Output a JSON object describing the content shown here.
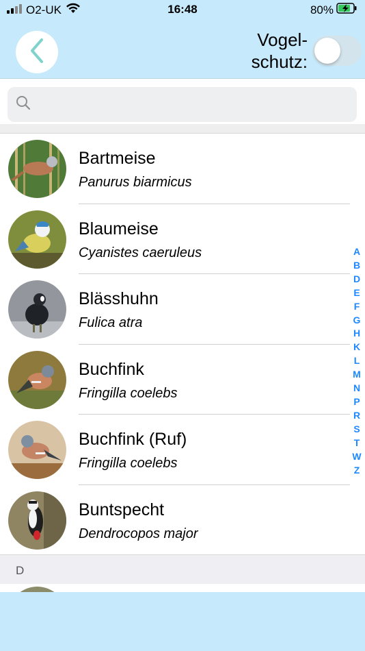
{
  "status": {
    "carrier": "O2-UK",
    "time": "16:48",
    "battery": "80%"
  },
  "header": {
    "toggle_label_line1": "Vogel-",
    "toggle_label_line2": "schutz:",
    "toggle_on": false
  },
  "search": {
    "value": "",
    "placeholder": ""
  },
  "birds": [
    {
      "name": "Bartmeise",
      "latin": "Panurus biarmicus"
    },
    {
      "name": "Blaumeise",
      "latin": "Cyanistes caeruleus"
    },
    {
      "name": "Blässhuhn",
      "latin": "Fulica atra"
    },
    {
      "name": "Buchfink",
      "latin": "Fringilla coelebs"
    },
    {
      "name": "Buchfink (Ruf)",
      "latin": "Fringilla coelebs"
    },
    {
      "name": "Buntspecht",
      "latin": "Dendrocopos major"
    }
  ],
  "section_next": "D",
  "index_letters": [
    "A",
    "B",
    "D",
    "E",
    "F",
    "G",
    "H",
    "K",
    "L",
    "M",
    "N",
    "P",
    "R",
    "S",
    "T",
    "W",
    "Z"
  ],
  "colors": {
    "header_bg": "#c6e9fb",
    "accent": "#1e88ff",
    "back_chevron": "#7fd3cc"
  }
}
